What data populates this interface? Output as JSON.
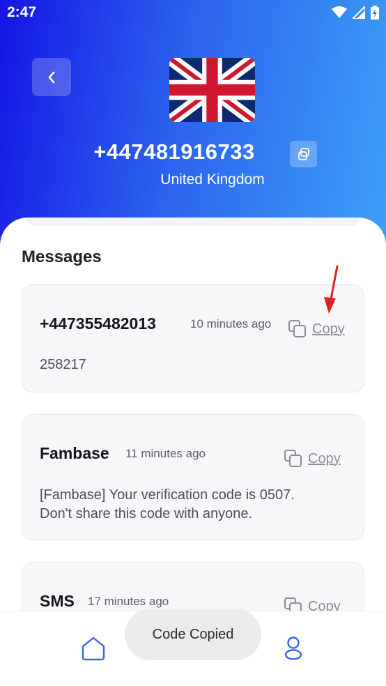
{
  "status": {
    "time": "2:47"
  },
  "header": {
    "phone_number": "+447481916733",
    "country": "United Kingdom",
    "flag_icon": "uk-flag-icon"
  },
  "messages": {
    "title": "Messages",
    "items": [
      {
        "sender": "+447355482013",
        "time": "10 minutes ago",
        "copy_label": "Copy",
        "body": "258217"
      },
      {
        "sender": "Fambase",
        "time": "11 minutes ago",
        "copy_label": "Copy",
        "body_line1": "[Fambase] Your verification code is 0507.",
        "body_line2": "Don't share this code with anyone."
      },
      {
        "sender": "SMS",
        "time": "17 minutes ago",
        "copy_label": "Copy"
      }
    ]
  },
  "toast": {
    "text": "Code Copied"
  },
  "colors": {
    "gradient_start": "#1515e6",
    "gradient_end": "#3ea1f7",
    "annotation_arrow": "#e02020"
  }
}
